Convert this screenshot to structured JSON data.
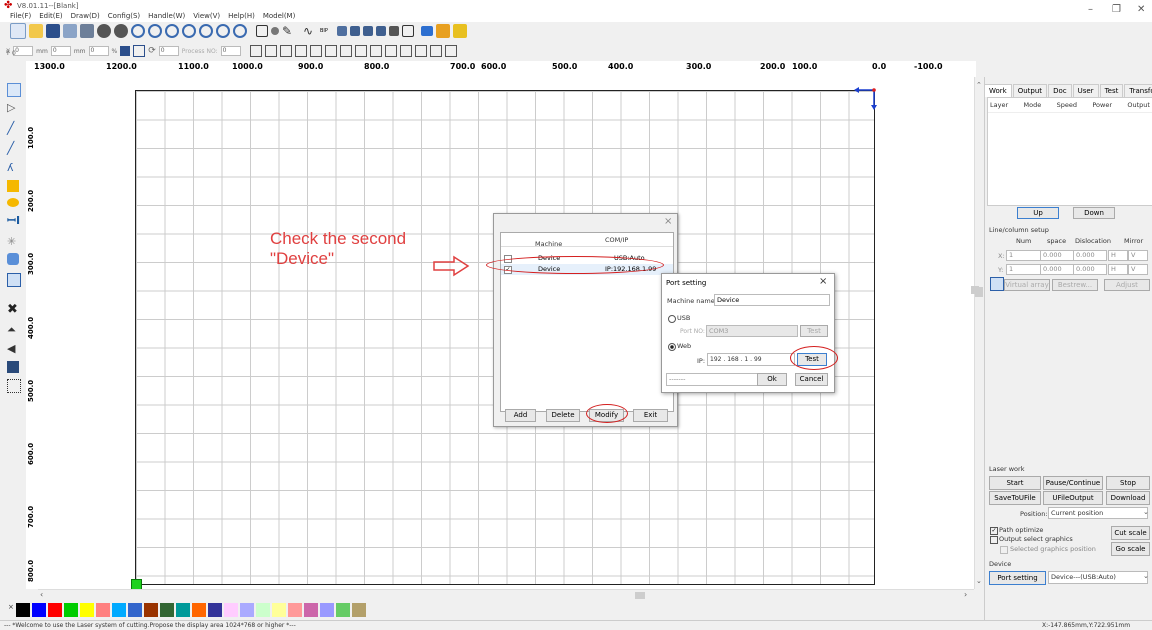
{
  "window": {
    "title": "V8.01.11--[Blank]",
    "minimize": "–",
    "maximize": "❐",
    "close": "✕"
  },
  "menu": [
    "File(F)",
    "Edit(E)",
    "Draw(D)",
    "Config(S)",
    "Handle(W)",
    "View(V)",
    "Help(H)",
    "Model(M)"
  ],
  "toolbar2": {
    "x_label": "X",
    "x_value": "0",
    "y_label": "Y",
    "y_value": "0",
    "unit_mm": "mm",
    "pct": "%",
    "rotate_value": "0",
    "process_label": "Process NO:",
    "process_value": "0"
  },
  "ruler_top": [
    "1300.0",
    "1200.0",
    "1100.0",
    "1000.0",
    "900.0",
    "800.0",
    "700.0",
    "600.0",
    "500.0",
    "400.0",
    "300.0",
    "200.0",
    "100.0",
    "0.0",
    "-100.0"
  ],
  "ruler_left": [
    "100.0",
    "200.0",
    "300.0",
    "400.0",
    "500.0",
    "600.0",
    "700.0",
    "800.0"
  ],
  "annotation": {
    "line1": "Check the second",
    "line2": "\"Device\""
  },
  "device_dialog": {
    "close": "×",
    "col_machine": "Machine",
    "col_comip": "COM/IP",
    "rows": [
      {
        "machine": "Device",
        "comip": "USB:Auto"
      },
      {
        "machine": "Device",
        "comip": "IP:192.168.1.99"
      }
    ],
    "buttons": {
      "add": "Add",
      "delete": "Delete",
      "modify": "Modify",
      "exit": "Exit"
    }
  },
  "port_dialog": {
    "title": "Port setting",
    "close": "×",
    "machine_name_label": "Machine name:",
    "machine_name": "Device",
    "usb_label": "USB",
    "port_no_label": "Port NO:",
    "port_no": "COM3",
    "test_usb": "Test",
    "web_label": "Web",
    "ip_label": "IP:",
    "ip": [
      "192",
      "168",
      "1",
      "99"
    ],
    "test_web": "Test",
    "status_field": "-------",
    "ok": "Ok",
    "cancel": "Cancel"
  },
  "right_panel": {
    "tabs": [
      "Work",
      "Output",
      "Doc",
      "User",
      "Test",
      "Transform"
    ],
    "layer_cols": [
      "Layer",
      "Mode",
      "Speed",
      "Power",
      "Output"
    ],
    "up": "Up",
    "down": "Down",
    "linecol": {
      "title": "Line/column setup",
      "num": "Num",
      "space": "space",
      "dislocation": "Dislocation",
      "mirror": "Mirror",
      "x": "X:",
      "y": "Y:",
      "x_num": "1",
      "y_num": "1",
      "x_space": "0.000",
      "y_space": "0.000",
      "x_disl": "0.000",
      "y_disl": "0.000",
      "h": "H",
      "v": "V",
      "virtual_array": "Virtual array",
      "bestrew": "Bestrew...",
      "adjust": "Adjust"
    },
    "laser_work": {
      "title": "Laser work",
      "start": "Start",
      "pause": "Pause/Continue",
      "stop": "Stop",
      "save_to_ufile": "SaveToUFile",
      "ufile_output": "UFileOutput",
      "download": "Download",
      "position_label": "Position:",
      "position_value": "Current position",
      "path_optimize": "Path optimize",
      "output_select": "Output select graphics",
      "selected_pos": "Selected graphics position",
      "cut_scale": "Cut scale",
      "go_scale": "Go scale"
    },
    "device": {
      "title": "Device",
      "port_setting": "Port setting",
      "device_value": "Device---(USB:Auto)"
    }
  },
  "status": {
    "message": "--- *Welcome to use the Laser system of cutting.Propose the display area 1024*768 or higher *---",
    "coords": "X:-147.865mm,Y:722.951mm"
  },
  "palette": [
    "#000000",
    "#0000ff",
    "#ff0000",
    "#00cc00",
    "#ffff00",
    "#ff8080",
    "#00aaff",
    "#3366cc",
    "#993300",
    "#336633",
    "#009999",
    "#ff6600",
    "#333399",
    "#ffccff",
    "#aaaaff",
    "#ccffcc",
    "#ffff99",
    "#ff9999",
    "#cc66aa",
    "#9999ff",
    "#66cc66",
    "#b3a06a"
  ]
}
